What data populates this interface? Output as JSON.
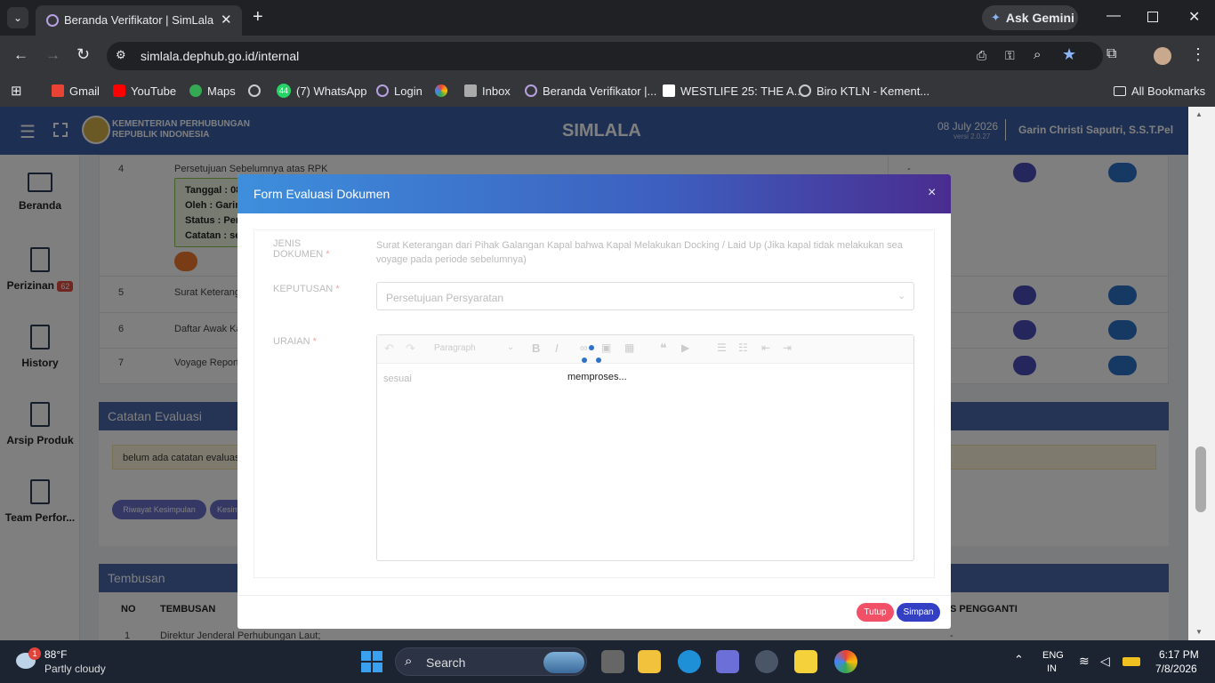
{
  "browser": {
    "tab_title": "Beranda Verifikator | SimLala",
    "url": "simlala.dephub.go.id/internal",
    "ask_gemini": "Ask Gemini",
    "bookmarks": [
      "Gmail",
      "YouTube",
      "Maps",
      "(7) WhatsApp",
      "Login",
      "Inbox",
      "Beranda Verifikator |...",
      "WESTLIFE 25: THE A...",
      "Biro KTLN - Kement..."
    ],
    "whatsapp_badge": "44",
    "all_bookmarks": "All Bookmarks"
  },
  "header": {
    "ministry_line1": "KEMENTERIAN PERHUBUNGAN",
    "ministry_line2": "REPUBLIK INDONESIA",
    "app_name": "SIMLALA",
    "date": "08 July 2026",
    "version": "versi 2.0.27",
    "user": "Garin Christi Saputri, S.S.T.Pel"
  },
  "sidebar": {
    "items": [
      {
        "label": "Beranda"
      },
      {
        "label": "Perizinan",
        "badge": "62"
      },
      {
        "label": "History"
      },
      {
        "label": "Arsip Produk"
      },
      {
        "label": "Team Perfor..."
      }
    ]
  },
  "background": {
    "rows": [
      {
        "no": "4",
        "text": "Persetujuan Sebelumnya atas RPK",
        "extra": "-"
      },
      {
        "no": "5",
        "text": "Surat Keterang"
      },
      {
        "no": "6",
        "text": "Daftar Awak Ka"
      },
      {
        "no": "7",
        "text": "Voyage Report"
      }
    ],
    "detail": {
      "tanggal": "Tanggal : 08",
      "oleh": "Oleh : Garin",
      "status": "Status : Pers",
      "catatan": "Catatan : se"
    },
    "catatan_title": "Catatan Evaluasi",
    "catatan_empty": "belum ada catatan evaluasi",
    "btn_riwayat": "Riwayat Kesimpulan",
    "btn_kesim": "Kesim",
    "tembusan_title": "Tembusan",
    "col_no": "NO",
    "col_tembusan": "TEMBUSAN",
    "col_pengganti": "S PENGGANTI",
    "tembusan_row_no": "1",
    "tembusan_row_text": "Direktur Jenderal Perhubungan Laut;",
    "tembusan_row_dash": "-"
  },
  "modal": {
    "title": "Form Evaluasi Dokumen",
    "close": "×",
    "label_jenis": "JENIS DOKUMEN",
    "label_keputusan": "KEPUTUSAN",
    "label_uraian": "URAIAN",
    "required": "*",
    "jenis_value": "Surat Keterangan dari Pihak Galangan Kapal bahwa Kapal Melakukan Docking / Laid Up (Jika kapal tidak melakukan sea voyage pada periode sebelumnya)",
    "keputusan_value": "Persetujuan Persyaratan",
    "editor_paragraph": "Paragraph",
    "editor_content": "sesuai",
    "loading": "memproses...",
    "btn_tutup": "Tutup",
    "btn_simpan": "Simpan"
  },
  "taskbar": {
    "weather_temp": "88°F",
    "weather_desc": "Partly cloudy",
    "weather_badge": "1",
    "search": "Search",
    "lang1": "ENG",
    "lang2": "IN",
    "time": "6:17 PM",
    "date": "7/8/2026"
  }
}
